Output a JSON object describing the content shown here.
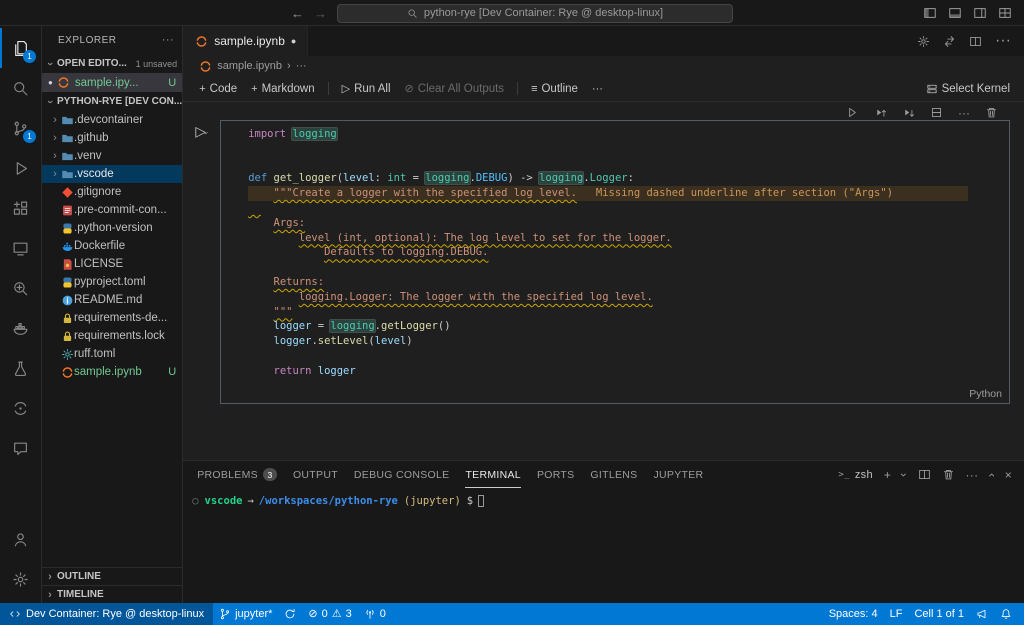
{
  "icons": {
    "arrow_left": "←",
    "arrow_right": "→",
    "more": "···",
    "chevron": "›",
    "close": "×",
    "plus": "+",
    "run": "▷",
    "dot": "●",
    "clear": "⊘",
    "outline_list": "≡",
    "error": "⊘",
    "warning": "⚠"
  },
  "title_bar": {
    "search_text": "python-rye [Dev Container: Rye @ desktop-linux]"
  },
  "activity_bar": {
    "items": [
      {
        "id": "explorer",
        "badge": "1",
        "active": true
      },
      {
        "id": "search"
      },
      {
        "id": "source-control",
        "badge": "1"
      },
      {
        "id": "run-and-debug"
      },
      {
        "id": "extensions"
      },
      {
        "id": "remote-explorer"
      },
      {
        "id": "gitlens"
      },
      {
        "id": "docker"
      },
      {
        "id": "testing"
      },
      {
        "id": "jupyter"
      },
      {
        "id": "comments"
      }
    ],
    "bottom_items": [
      {
        "id": "accounts"
      },
      {
        "id": "settings"
      }
    ]
  },
  "sidebar": {
    "title": "EXPLORER",
    "open_editors": {
      "header": "OPEN EDITO...",
      "badge": "1 unsaved",
      "items": [
        {
          "label": "sample.ipy...",
          "status": "U"
        }
      ]
    },
    "workspace": {
      "header": "PYTHON-RYE [DEV CON...",
      "files": [
        {
          "label": ".devcontainer",
          "icon": "folder",
          "kind": "folder"
        },
        {
          "label": ".github",
          "icon": "folder",
          "kind": "folder"
        },
        {
          "label": ".venv",
          "icon": "folder",
          "kind": "folder"
        },
        {
          "label": ".vscode",
          "icon": "folder",
          "kind": "folder",
          "selected": true
        },
        {
          "label": ".gitignore",
          "icon": "git"
        },
        {
          "label": ".pre-commit-con...",
          "icon": "yaml"
        },
        {
          "label": ".python-version",
          "icon": "python"
        },
        {
          "label": "Dockerfile",
          "icon": "docker"
        },
        {
          "label": "LICENSE",
          "icon": "license"
        },
        {
          "label": "pyproject.toml",
          "icon": "python"
        },
        {
          "label": "README.md",
          "icon": "readme"
        },
        {
          "label": "requirements-de...",
          "icon": "lock"
        },
        {
          "label": "requirements.lock",
          "icon": "lock"
        },
        {
          "label": "ruff.toml",
          "icon": "gear"
        },
        {
          "label": "sample.ipynb",
          "icon": "jupyter",
          "git_status": "U",
          "untracked": true
        }
      ]
    },
    "outline_header": "OUTLINE",
    "timeline_header": "TIMELINE"
  },
  "editor": {
    "tab": {
      "label": "sample.ipynb"
    },
    "breadcrumb": {
      "file": "sample.ipynb"
    },
    "toolbar": {
      "code": "Code",
      "markdown": "Markdown",
      "run_all": "Run All",
      "clear_outputs": "Clear All Outputs",
      "outline": "Outline",
      "select_kernel": "Select Kernel"
    },
    "cell": {
      "language": "Python",
      "code_lines": [
        {
          "tokens": [
            {
              "c": "kw",
              "t": "import "
            },
            {
              "c": "mod",
              "t": "logging"
            }
          ]
        },
        {
          "tokens": []
        },
        {
          "tokens": []
        },
        {
          "tokens": [
            {
              "c": "def",
              "t": "def "
            },
            {
              "c": "fn",
              "t": "get_logger"
            },
            {
              "c": "plain",
              "t": "("
            },
            {
              "c": "var",
              "t": "level"
            },
            {
              "c": "plain",
              "t": ": "
            },
            {
              "c": "type",
              "t": "int"
            },
            {
              "c": "plain",
              "t": " = "
            },
            {
              "c": "mod",
              "t": "logging"
            },
            {
              "c": "plain",
              "t": "."
            },
            {
              "c": "const",
              "t": "DEBUG"
            },
            {
              "c": "plain",
              "t": ") -> "
            },
            {
              "c": "mod",
              "t": "logging"
            },
            {
              "c": "plain",
              "t": "."
            },
            {
              "c": "type",
              "t": "Logger"
            },
            {
              "c": "plain",
              "t": ":"
            }
          ]
        },
        {
          "warn": true,
          "tokens": [
            {
              "c": "str",
              "t": "    "
            },
            {
              "c": "str",
              "w": true,
              "t": "\"\"\"Create a logger with the specified log level."
            },
            {
              "c": "plain",
              "t": "   "
            },
            {
              "c": "ann",
              "t": "Missing dashed underline after section (\"Args\")"
            }
          ]
        },
        {
          "tokens": [
            {
              "c": "str",
              "w": true,
              "t": "  "
            }
          ]
        },
        {
          "tokens": [
            {
              "c": "plain",
              "t": "    "
            },
            {
              "c": "str",
              "w": true,
              "t": "Args:"
            }
          ]
        },
        {
          "tokens": [
            {
              "c": "plain",
              "t": "        "
            },
            {
              "c": "str",
              "w": true,
              "t": "level (int, optional): The log level to set for the logger."
            }
          ]
        },
        {
          "tokens": [
            {
              "c": "plain",
              "t": "            "
            },
            {
              "c": "str",
              "w": true,
              "t": "Defaults to logging.DEBUG."
            }
          ]
        },
        {
          "tokens": []
        },
        {
          "tokens": [
            {
              "c": "plain",
              "t": "    "
            },
            {
              "c": "str",
              "w": true,
              "t": "Returns:"
            }
          ]
        },
        {
          "tokens": [
            {
              "c": "plain",
              "t": "        "
            },
            {
              "c": "str",
              "w": true,
              "t": "logging.Logger: The logger with the specified log level."
            }
          ]
        },
        {
          "tokens": [
            {
              "c": "plain",
              "t": "    "
            },
            {
              "c": "str",
              "w": true,
              "t": "\"\"\""
            }
          ]
        },
        {
          "tokens": [
            {
              "c": "plain",
              "t": "    "
            },
            {
              "c": "var",
              "t": "logger"
            },
            {
              "c": "plain",
              "t": " = "
            },
            {
              "c": "mod",
              "t": "logging"
            },
            {
              "c": "plain",
              "t": "."
            },
            {
              "c": "fn",
              "t": "getLogger"
            },
            {
              "c": "plain",
              "t": "()"
            }
          ]
        },
        {
          "tokens": [
            {
              "c": "plain",
              "t": "    "
            },
            {
              "c": "var",
              "t": "logger"
            },
            {
              "c": "plain",
              "t": "."
            },
            {
              "c": "fn",
              "t": "setLevel"
            },
            {
              "c": "plain",
              "t": "("
            },
            {
              "c": "var",
              "t": "level"
            },
            {
              "c": "plain",
              "t": ")"
            }
          ]
        },
        {
          "tokens": []
        },
        {
          "tokens": [
            {
              "c": "plain",
              "t": "    "
            },
            {
              "c": "kw",
              "t": "return "
            },
            {
              "c": "var",
              "t": "logger"
            }
          ]
        }
      ]
    }
  },
  "panel": {
    "tabs": [
      {
        "label": "PROBLEMS",
        "badge": "3"
      },
      {
        "label": "OUTPUT"
      },
      {
        "label": "DEBUG CONSOLE"
      },
      {
        "label": "TERMINAL",
        "active": true
      },
      {
        "label": "PORTS"
      },
      {
        "label": "GITLENS"
      },
      {
        "label": "JUPYTER"
      }
    ],
    "shell_label": "zsh",
    "terminal": {
      "decoration": "○",
      "user": "vscode",
      "arrow": "→",
      "path": "/workspaces/python-rye",
      "venv": "(jupyter)",
      "prompt": "$"
    }
  },
  "status_bar": {
    "remote": "Dev Container: Rye @ desktop-linux",
    "branch": "jupyter*",
    "errors": "0",
    "warnings": "3",
    "ports": "0",
    "spaces": "Spaces: 4",
    "eol": "LF",
    "cell_indicator": "Cell 1 of 1"
  }
}
